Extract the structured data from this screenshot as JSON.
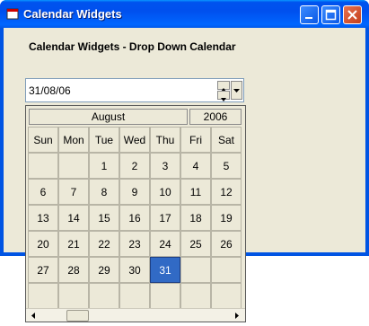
{
  "window": {
    "title": "Calendar Widgets"
  },
  "heading": "Calendar Widgets - Drop Down Calendar",
  "date_input": {
    "value": "31/08/06"
  },
  "calendar": {
    "month": "August",
    "year": "2006",
    "weekdays": [
      "Sun",
      "Mon",
      "Tue",
      "Wed",
      "Thu",
      "Fri",
      "Sat"
    ],
    "weeks": [
      [
        "",
        "",
        "1",
        "2",
        "3",
        "4",
        "5"
      ],
      [
        "6",
        "7",
        "8",
        "9",
        "10",
        "11",
        "12"
      ],
      [
        "13",
        "14",
        "15",
        "16",
        "17",
        "18",
        "19"
      ],
      [
        "20",
        "21",
        "22",
        "23",
        "24",
        "25",
        "26"
      ],
      [
        "27",
        "28",
        "29",
        "30",
        "31",
        "",
        ""
      ],
      [
        "",
        "",
        "",
        "",
        "",
        "",
        ""
      ]
    ],
    "selected_day": "31"
  },
  "icons": {
    "app": "calendar-app-icon",
    "minimize": "minimize-icon",
    "maximize": "maximize-icon",
    "close": "close-icon",
    "spin_up": "arrow-up-icon",
    "spin_down": "arrow-down-icon",
    "dropdown": "chevron-down-icon",
    "scroll_left": "arrow-left-icon",
    "scroll_right": "arrow-right-icon"
  },
  "colors": {
    "titlebar": "#0054e3",
    "selection": "#316ac5",
    "face": "#ece9d8"
  }
}
